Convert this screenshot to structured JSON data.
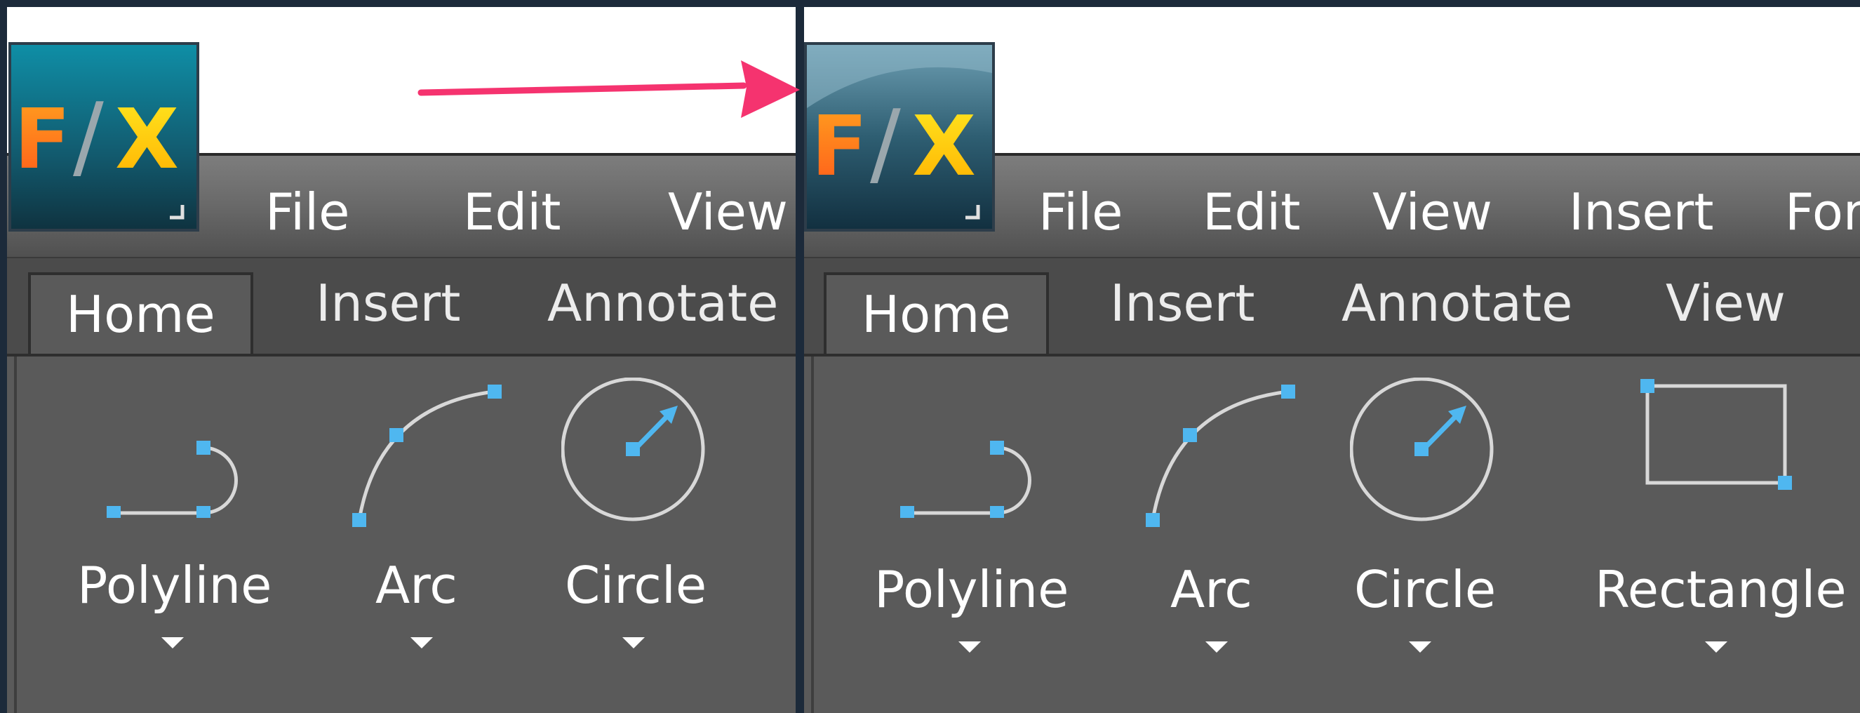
{
  "panels": {
    "left": {
      "logo": {
        "icon": "fx-app-icon",
        "text_f": "F",
        "text_slash": "/",
        "text_x": "X"
      },
      "menu": [
        "File",
        "Edit",
        "View"
      ],
      "tabs": [
        "Home",
        "Insert",
        "Annotate"
      ],
      "tools": [
        {
          "label": "Polyline",
          "icon": "polyline-icon"
        },
        {
          "label": "Arc",
          "icon": "arc-icon"
        },
        {
          "label": "Circle",
          "icon": "circle-icon"
        }
      ]
    },
    "right": {
      "logo": {
        "icon": "fx-app-icon",
        "text_f": "F",
        "text_slash": "/",
        "text_x": "X"
      },
      "menu": [
        "File",
        "Edit",
        "View",
        "Insert",
        "For"
      ],
      "tabs": [
        "Home",
        "Insert",
        "Annotate",
        "View"
      ],
      "tools": [
        {
          "label": "Polyline",
          "icon": "polyline-icon"
        },
        {
          "label": "Arc",
          "icon": "arc-icon"
        },
        {
          "label": "Circle",
          "icon": "circle-icon"
        },
        {
          "label": "Rectangle",
          "icon": "rectangle-icon"
        }
      ]
    }
  },
  "colors": {
    "accent_blue": "#4fb7f0",
    "arrow_pink": "#f5336f",
    "ribbon_gray": "#5a5a5a"
  }
}
